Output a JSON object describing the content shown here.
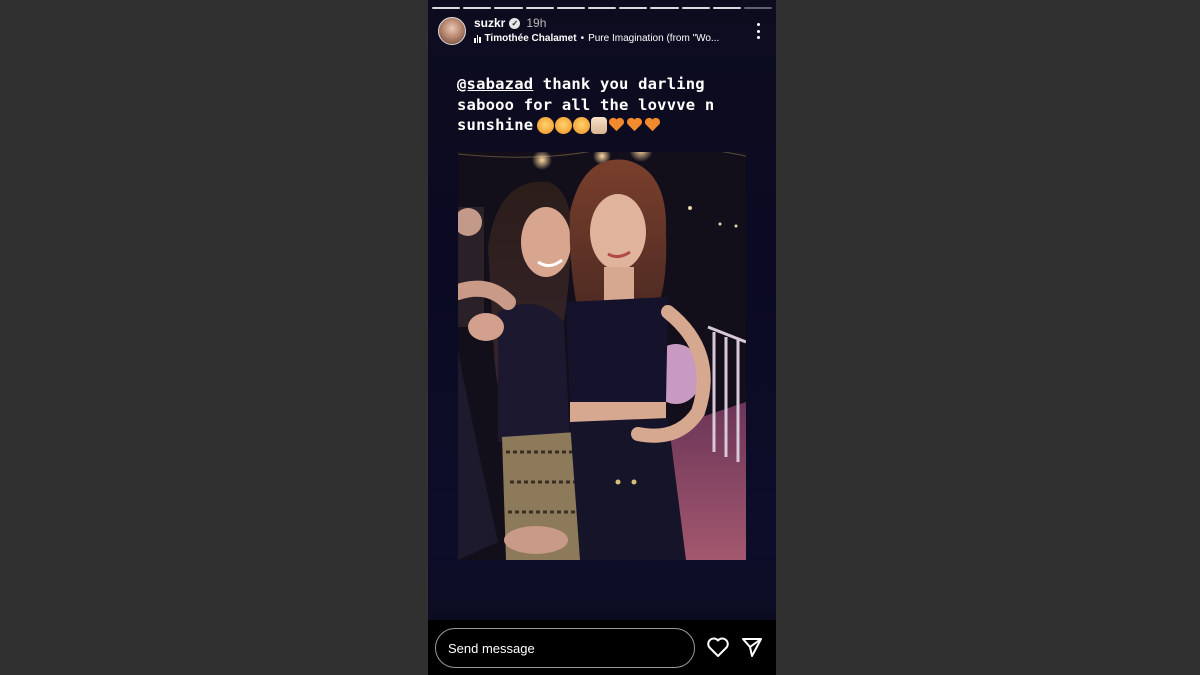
{
  "story": {
    "progress_segments": 11,
    "progress_completed": 10,
    "user": {
      "username": "suzkr",
      "verified": true,
      "time_ago": "19h"
    },
    "music": {
      "icon": "music-bars-icon",
      "artist": "Timothée Chalamet",
      "separator": "•",
      "track": "Pure Imagination (from \"Wo..."
    },
    "more_icon": "more-vertical-icon",
    "caption": {
      "mention": "@sabazad",
      "line1_rest": " thank you darling",
      "line2": "sabooo for all the lovvve n",
      "line3": "sunshine"
    },
    "emojis": [
      "smiling-face-with-hearts",
      "smiling-face-with-hearts",
      "smiling-face-with-hearts",
      "raising-hands",
      "orange-heart",
      "orange-heart",
      "orange-heart"
    ]
  },
  "bottom_bar": {
    "message_placeholder": "Send message",
    "like_icon": "heart-outline-icon",
    "share_icon": "send-paper-plane-icon"
  },
  "colors": {
    "page_background": "#303030",
    "story_background": "#0d0c1f",
    "heart_emoji": "#f28a2e"
  }
}
